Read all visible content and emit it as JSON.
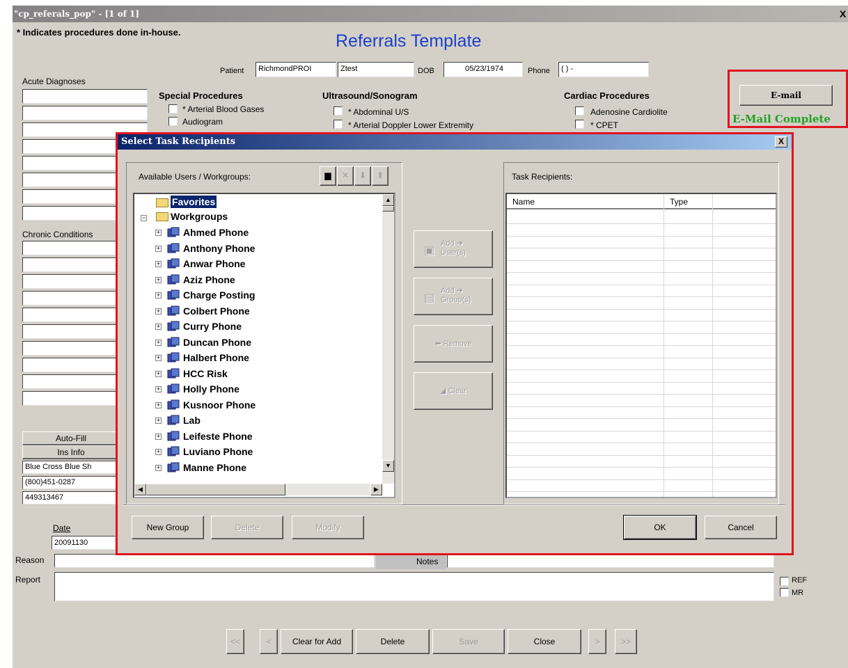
{
  "window": {
    "title": "\"cp_referals_pop\" - [1 of 1]",
    "close": "X"
  },
  "note": "* Indicates procedures done in-house.",
  "page_title": "Referrals Template",
  "patient": {
    "label": "Patient",
    "last": "RichmondPROI",
    "first": "Ztest",
    "dob_label": "DOB",
    "dob": "05/23/1974",
    "phone_label": "Phone",
    "phone": "( ) -"
  },
  "left": {
    "acute_label": "Acute Diagnoses",
    "chronic_label": "Chronic Conditions",
    "autofill": "Auto-Fill",
    "ins_info": "Ins Info",
    "insurance": [
      "Blue Cross Blue Sh",
      "(800)451-0287",
      "449313467"
    ],
    "date_label": "Date",
    "date": "20091130",
    "reason_label": "Reason",
    "report_label": "Report"
  },
  "sections": {
    "special": {
      "title": "Special Procedures",
      "items": [
        "* Arterial Blood Gases",
        "Audiogram"
      ]
    },
    "ultrasound": {
      "title": "Ultrasound/Sonogram",
      "items": [
        "* Abdominal U/S",
        "* Arterial Doppler Lower Extremity"
      ]
    },
    "cardiac": {
      "title": "Cardiac Procedures",
      "items": [
        "Adenosine Cardiolite",
        "* CPET"
      ]
    }
  },
  "email": {
    "button": "E-mail",
    "status": "E-Mail Complete"
  },
  "notes_label": "Notes",
  "ref_label": "REF",
  "mr_label": "MR",
  "bottom_nav": {
    "first": "<<",
    "prev": "<",
    "clear": "Clear for Add",
    "delete": "Delete",
    "save": "Save",
    "close": "Close",
    "next": ">",
    "last": ">>"
  },
  "dialog": {
    "title": "Select Task Recipients",
    "close": "X",
    "available_label": "Available Users / Workgroups:",
    "recipients_label": "Task Recipients:",
    "columns": [
      "Name",
      "Type"
    ],
    "tree": {
      "favorites": "Favorites",
      "workgroups": "Workgroups",
      "items": [
        "Ahmed Phone",
        "Anthony Phone",
        "Anwar Phone",
        "Aziz Phone",
        "Charge Posting",
        "Colbert Phone",
        "Curry Phone",
        "Duncan Phone",
        "Halbert Phone",
        "HCC Risk",
        "Holly Phone",
        "Kusnoor Phone",
        "Lab",
        "Leifeste Phone",
        "Luviano Phone",
        "Manne Phone"
      ]
    },
    "add_users": "Add ➜ User(s)",
    "add_groups": "Add ➜ Group(s)",
    "remove": "Remove",
    "clear": "Clear",
    "new_group": "New Group",
    "delete": "Delete",
    "modify": "Modify",
    "ok": "OK",
    "cancel": "Cancel"
  }
}
